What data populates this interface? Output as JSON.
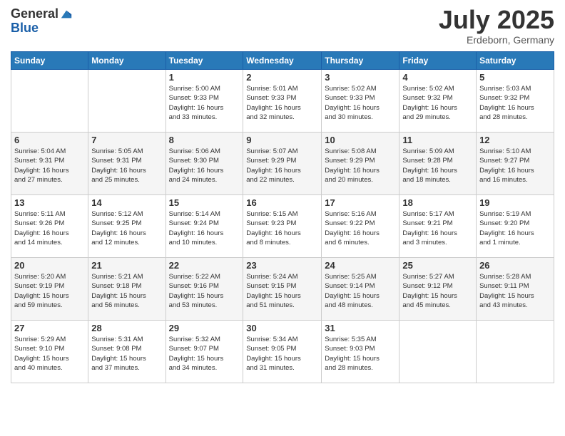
{
  "logo": {
    "general": "General",
    "blue": "Blue"
  },
  "title": "July 2025",
  "location": "Erdeborn, Germany",
  "days_header": [
    "Sunday",
    "Monday",
    "Tuesday",
    "Wednesday",
    "Thursday",
    "Friday",
    "Saturday"
  ],
  "weeks": [
    [
      {
        "day": "",
        "info": ""
      },
      {
        "day": "",
        "info": ""
      },
      {
        "day": "1",
        "info": "Sunrise: 5:00 AM\nSunset: 9:33 PM\nDaylight: 16 hours\nand 33 minutes."
      },
      {
        "day": "2",
        "info": "Sunrise: 5:01 AM\nSunset: 9:33 PM\nDaylight: 16 hours\nand 32 minutes."
      },
      {
        "day": "3",
        "info": "Sunrise: 5:02 AM\nSunset: 9:33 PM\nDaylight: 16 hours\nand 30 minutes."
      },
      {
        "day": "4",
        "info": "Sunrise: 5:02 AM\nSunset: 9:32 PM\nDaylight: 16 hours\nand 29 minutes."
      },
      {
        "day": "5",
        "info": "Sunrise: 5:03 AM\nSunset: 9:32 PM\nDaylight: 16 hours\nand 28 minutes."
      }
    ],
    [
      {
        "day": "6",
        "info": "Sunrise: 5:04 AM\nSunset: 9:31 PM\nDaylight: 16 hours\nand 27 minutes."
      },
      {
        "day": "7",
        "info": "Sunrise: 5:05 AM\nSunset: 9:31 PM\nDaylight: 16 hours\nand 25 minutes."
      },
      {
        "day": "8",
        "info": "Sunrise: 5:06 AM\nSunset: 9:30 PM\nDaylight: 16 hours\nand 24 minutes."
      },
      {
        "day": "9",
        "info": "Sunrise: 5:07 AM\nSunset: 9:29 PM\nDaylight: 16 hours\nand 22 minutes."
      },
      {
        "day": "10",
        "info": "Sunrise: 5:08 AM\nSunset: 9:29 PM\nDaylight: 16 hours\nand 20 minutes."
      },
      {
        "day": "11",
        "info": "Sunrise: 5:09 AM\nSunset: 9:28 PM\nDaylight: 16 hours\nand 18 minutes."
      },
      {
        "day": "12",
        "info": "Sunrise: 5:10 AM\nSunset: 9:27 PM\nDaylight: 16 hours\nand 16 minutes."
      }
    ],
    [
      {
        "day": "13",
        "info": "Sunrise: 5:11 AM\nSunset: 9:26 PM\nDaylight: 16 hours\nand 14 minutes."
      },
      {
        "day": "14",
        "info": "Sunrise: 5:12 AM\nSunset: 9:25 PM\nDaylight: 16 hours\nand 12 minutes."
      },
      {
        "day": "15",
        "info": "Sunrise: 5:14 AM\nSunset: 9:24 PM\nDaylight: 16 hours\nand 10 minutes."
      },
      {
        "day": "16",
        "info": "Sunrise: 5:15 AM\nSunset: 9:23 PM\nDaylight: 16 hours\nand 8 minutes."
      },
      {
        "day": "17",
        "info": "Sunrise: 5:16 AM\nSunset: 9:22 PM\nDaylight: 16 hours\nand 6 minutes."
      },
      {
        "day": "18",
        "info": "Sunrise: 5:17 AM\nSunset: 9:21 PM\nDaylight: 16 hours\nand 3 minutes."
      },
      {
        "day": "19",
        "info": "Sunrise: 5:19 AM\nSunset: 9:20 PM\nDaylight: 16 hours\nand 1 minute."
      }
    ],
    [
      {
        "day": "20",
        "info": "Sunrise: 5:20 AM\nSunset: 9:19 PM\nDaylight: 15 hours\nand 59 minutes."
      },
      {
        "day": "21",
        "info": "Sunrise: 5:21 AM\nSunset: 9:18 PM\nDaylight: 15 hours\nand 56 minutes."
      },
      {
        "day": "22",
        "info": "Sunrise: 5:22 AM\nSunset: 9:16 PM\nDaylight: 15 hours\nand 53 minutes."
      },
      {
        "day": "23",
        "info": "Sunrise: 5:24 AM\nSunset: 9:15 PM\nDaylight: 15 hours\nand 51 minutes."
      },
      {
        "day": "24",
        "info": "Sunrise: 5:25 AM\nSunset: 9:14 PM\nDaylight: 15 hours\nand 48 minutes."
      },
      {
        "day": "25",
        "info": "Sunrise: 5:27 AM\nSunset: 9:12 PM\nDaylight: 15 hours\nand 45 minutes."
      },
      {
        "day": "26",
        "info": "Sunrise: 5:28 AM\nSunset: 9:11 PM\nDaylight: 15 hours\nand 43 minutes."
      }
    ],
    [
      {
        "day": "27",
        "info": "Sunrise: 5:29 AM\nSunset: 9:10 PM\nDaylight: 15 hours\nand 40 minutes."
      },
      {
        "day": "28",
        "info": "Sunrise: 5:31 AM\nSunset: 9:08 PM\nDaylight: 15 hours\nand 37 minutes."
      },
      {
        "day": "29",
        "info": "Sunrise: 5:32 AM\nSunset: 9:07 PM\nDaylight: 15 hours\nand 34 minutes."
      },
      {
        "day": "30",
        "info": "Sunrise: 5:34 AM\nSunset: 9:05 PM\nDaylight: 15 hours\nand 31 minutes."
      },
      {
        "day": "31",
        "info": "Sunrise: 5:35 AM\nSunset: 9:03 PM\nDaylight: 15 hours\nand 28 minutes."
      },
      {
        "day": "",
        "info": ""
      },
      {
        "day": "",
        "info": ""
      }
    ]
  ]
}
